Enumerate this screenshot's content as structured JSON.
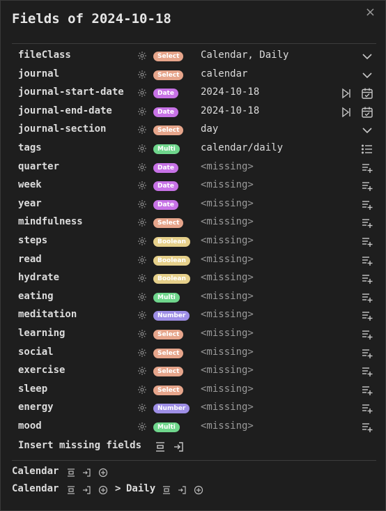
{
  "modal": {
    "title": "Fields of 2024-10-18",
    "close_symbol": "×"
  },
  "colors": {
    "select": "#e6a58b",
    "date": "#c772e6",
    "multi": "#6fd68c",
    "boolean": "#e6d08a",
    "number": "#9e8ee6"
  },
  "fields": [
    {
      "name": "fileClass",
      "type": "Select",
      "value": "Calendar, Daily",
      "action": "chevron-down-icon"
    },
    {
      "name": "journal",
      "type": "Select",
      "value": "calendar",
      "action": "chevron-down-icon"
    },
    {
      "name": "journal-start-date",
      "type": "Date",
      "value": "2024-10-18",
      "action": "date"
    },
    {
      "name": "journal-end-date",
      "type": "Date",
      "value": "2024-10-18",
      "action": "date"
    },
    {
      "name": "journal-section",
      "type": "Select",
      "value": "day",
      "action": "chevron-down-icon"
    },
    {
      "name": "tags",
      "type": "Multi",
      "value": "calendar/daily",
      "action": "list-icon"
    },
    {
      "name": "quarter",
      "type": "Date",
      "value": "<missing>",
      "action": "add-list-icon"
    },
    {
      "name": "week",
      "type": "Date",
      "value": "<missing>",
      "action": "add-list-icon"
    },
    {
      "name": "year",
      "type": "Date",
      "value": "<missing>",
      "action": "add-list-icon"
    },
    {
      "name": "mindfulness",
      "type": "Select",
      "value": "<missing>",
      "action": "add-list-icon"
    },
    {
      "name": "steps",
      "type": "Boolean",
      "value": "<missing>",
      "action": "add-list-icon"
    },
    {
      "name": "read",
      "type": "Boolean",
      "value": "<missing>",
      "action": "add-list-icon"
    },
    {
      "name": "hydrate",
      "type": "Boolean",
      "value": "<missing>",
      "action": "add-list-icon"
    },
    {
      "name": "eating",
      "type": "Multi",
      "value": "<missing>",
      "action": "add-list-icon"
    },
    {
      "name": "meditation",
      "type": "Number",
      "value": "<missing>",
      "action": "add-list-icon"
    },
    {
      "name": "learning",
      "type": "Select",
      "value": "<missing>",
      "action": "add-list-icon"
    },
    {
      "name": "social",
      "type": "Select",
      "value": "<missing>",
      "action": "add-list-icon"
    },
    {
      "name": "exercise",
      "type": "Select",
      "value": "<missing>",
      "action": "add-list-icon"
    },
    {
      "name": "sleep",
      "type": "Select",
      "value": "<missing>",
      "action": "add-list-icon"
    },
    {
      "name": "energy",
      "type": "Number",
      "value": "<missing>",
      "action": "add-list-icon"
    },
    {
      "name": "mood",
      "type": "Multi",
      "value": "<missing>",
      "action": "add-list-icon"
    }
  ],
  "insert_missing": {
    "label": "Insert missing fields"
  },
  "file_classes": {
    "line1": {
      "class": "Calendar"
    },
    "line2": {
      "class": "Calendar",
      "arrow": ">",
      "subclass": "Daily"
    }
  }
}
